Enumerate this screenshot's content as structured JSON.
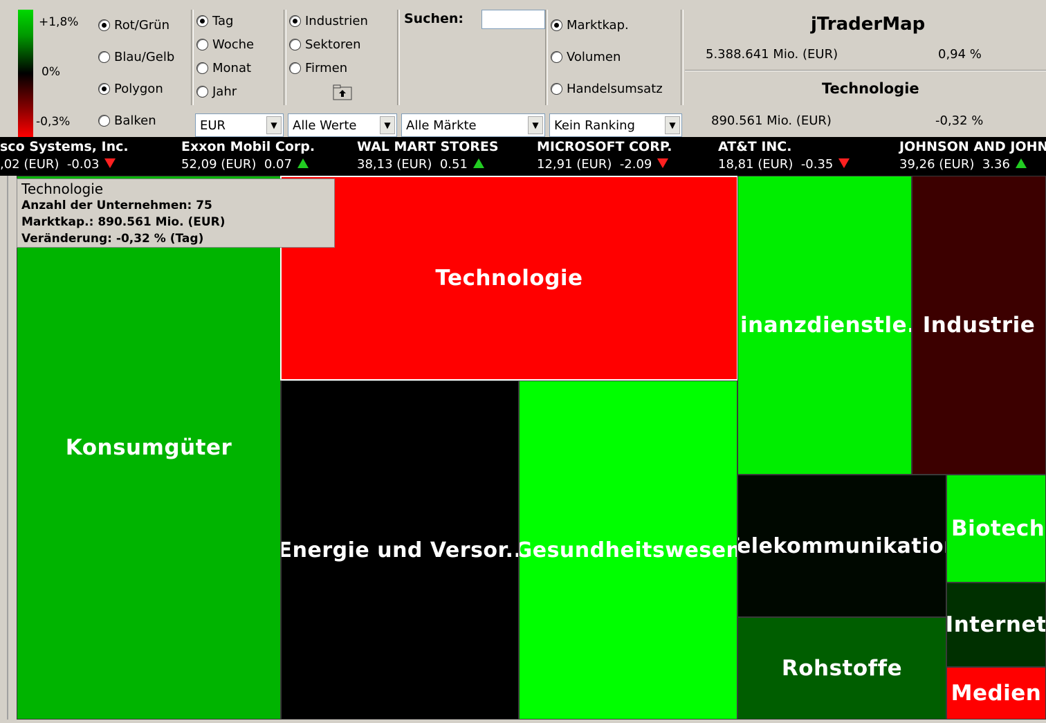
{
  "legend": {
    "max": "+1,8%",
    "mid": "0%",
    "min": "-0,3%",
    "colors": {
      "positive": "#00d800",
      "neutral": "#000000",
      "negative": "#ff0000"
    }
  },
  "color_scheme": {
    "options": [
      {
        "label": "Rot/Grün",
        "checked": true
      },
      {
        "label": "Blau/Gelb",
        "checked": false
      },
      {
        "label": "Polygon",
        "checked": true
      },
      {
        "label": "Balken",
        "checked": false
      }
    ]
  },
  "period": {
    "options": [
      {
        "label": "Tag",
        "checked": true
      },
      {
        "label": "Woche",
        "checked": false
      },
      {
        "label": "Monat",
        "checked": false
      },
      {
        "label": "Jahr",
        "checked": false
      }
    ]
  },
  "grouping": {
    "options": [
      {
        "label": "Industrien",
        "checked": true
      },
      {
        "label": "Sektoren",
        "checked": false
      },
      {
        "label": "Firmen",
        "checked": false
      }
    ],
    "up_icon": "folder-up-icon"
  },
  "search": {
    "label": "Suchen:",
    "value": ""
  },
  "size_by": {
    "options": [
      {
        "label": "Marktkap.",
        "checked": true
      },
      {
        "label": "Volumen",
        "checked": false
      },
      {
        "label": "Handelsumsatz",
        "checked": false
      }
    ]
  },
  "dropdowns": {
    "currency": "EUR",
    "values": "Alle Werte",
    "markets": "Alle Märkte",
    "ranking": "Kein Ranking"
  },
  "summary": {
    "app_title": "jTraderMap",
    "total_cap": "5.388.641 Mio. (EUR)",
    "total_change": "0,94 %",
    "selected_title": "Technologie",
    "selected_cap": "890.561 Mio. (EUR)",
    "selected_change": "-0,32 %"
  },
  "ticker": [
    {
      "name": "sco Systems, Inc.",
      "value": ",02 (EUR)",
      "change": "-0.03",
      "dir": "down"
    },
    {
      "name": "Exxon Mobil Corp.",
      "value": "52,09 (EUR)",
      "change": "0.07",
      "dir": "up"
    },
    {
      "name": "WAL MART STORES",
      "value": "38,13 (EUR)",
      "change": "0.51",
      "dir": "up"
    },
    {
      "name": "MICROSOFT CORP.",
      "value": "12,91 (EUR)",
      "change": "-2.09",
      "dir": "down"
    },
    {
      "name": "AT&T INC.",
      "value": "18,81 (EUR)",
      "change": "-0.35",
      "dir": "down"
    },
    {
      "name": "JOHNSON AND JOHN",
      "value": "39,26 (EUR)",
      "change": "3.36",
      "dir": "up"
    }
  ],
  "tooltip": {
    "title": "Technologie",
    "line1": "Anzahl der Unternehmen: 75",
    "line2": "Marktkap.: 890.561 Mio. (EUR)",
    "line3": "Veränderung:  -0,32 % (Tag)"
  },
  "tiles": [
    {
      "label": "Konsumgüter",
      "color": "#00b400"
    },
    {
      "label": "Technologie",
      "color": "#ff0000"
    },
    {
      "label": "Energie und Versor..",
      "color": "#000000"
    },
    {
      "label": "Gesundheitswesen",
      "color": "#00ff00"
    },
    {
      "label": "Finanzdienstle..",
      "color": "#00ee00"
    },
    {
      "label": "Industrie",
      "color": "#3c0000"
    },
    {
      "label": "Telekommunikation",
      "color": "#000800"
    },
    {
      "label": "Rohstoffe",
      "color": "#005e00"
    },
    {
      "label": "Biotech..",
      "color": "#00ee00"
    },
    {
      "label": "Internet",
      "color": "#003000"
    },
    {
      "label": "Medien",
      "color": "#ff0000"
    }
  ]
}
